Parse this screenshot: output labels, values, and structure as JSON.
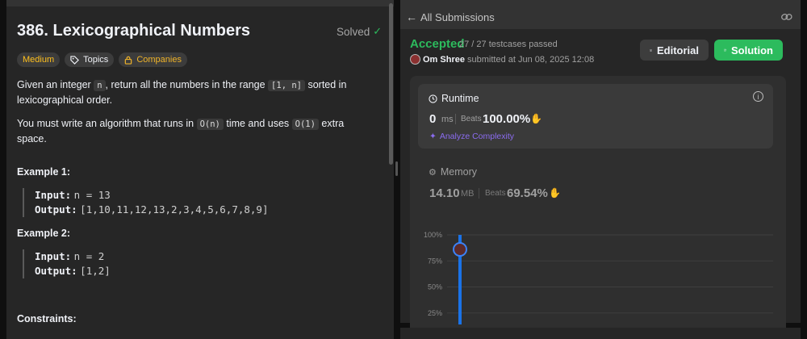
{
  "problem": {
    "title": "386. Lexicographical Numbers",
    "status": "Solved",
    "tags": [
      "Medium",
      "Topics",
      "Companies"
    ],
    "desc_p1": {
      "t1": "Given an integer ",
      "c1": "n",
      "t2": ", return all the numbers in the range ",
      "c2": "[1, n]",
      "t3": " sorted in lexicographical order."
    },
    "desc_p2": {
      "t1": "You must write an algorithm that runs in ",
      "c1": "O(n)",
      "t2": " time and uses ",
      "c2": "O(1)",
      "t3": " extra space."
    },
    "examples": [
      {
        "title": "Example 1:",
        "input_label": "Input:",
        "input": "n = 13",
        "output_label": "Output:",
        "output": "[1,10,11,12,13,2,3,4,5,6,7,8,9]"
      },
      {
        "title": "Example 2:",
        "input_label": "Input:",
        "input": "n = 2",
        "output_label": "Output:",
        "output": "[1,2]"
      }
    ],
    "constraints_title": "Constraints:"
  },
  "submission": {
    "header_title": "All Submissions",
    "status": "Accepted",
    "testcases": "27 / 27 testcases passed",
    "user": "Om Shree",
    "submitted_text": "submitted at Jun 08, 2025 12:08",
    "editorial_label": "Editorial",
    "solution_label": "Solution",
    "runtime": {
      "label": "Runtime",
      "value": "0",
      "unit": "ms",
      "beats_label": "Beats",
      "beats": "100.00%",
      "analyze_label": "Analyze Complexity"
    },
    "memory": {
      "label": "Memory",
      "value": "14.10",
      "unit": "MB",
      "beats_label": "Beats",
      "beats": "69.54%"
    }
  },
  "chart_data": {
    "type": "bar",
    "ytick_labels": [
      "100%",
      "75%",
      "50%",
      "25%"
    ],
    "ylim": [
      0,
      100
    ],
    "values": [
      100
    ],
    "bar_color": "#1a73e8",
    "grid": true
  },
  "colors": {
    "accent_green": "#2cbb5d",
    "medium_yellow": "#ffc01e",
    "analyze_purple": "#8b6cf0"
  },
  "icons": [
    "back-arrow-icon",
    "link-icon",
    "check-circle-icon",
    "tag-icon",
    "lock-icon",
    "book-icon",
    "edit-icon",
    "clock-icon",
    "info-icon",
    "sparkle-icon",
    "chip-icon",
    "clap-icon"
  ]
}
